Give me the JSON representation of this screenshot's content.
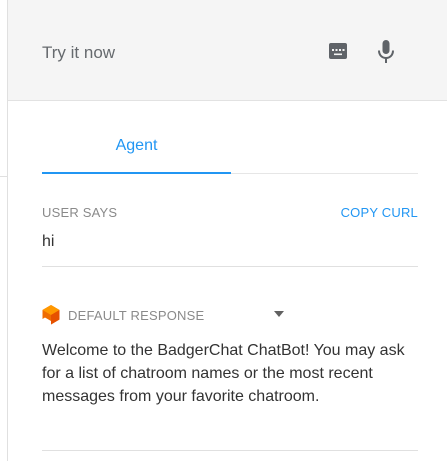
{
  "try_it": {
    "placeholder": "Try it now",
    "keyboard_icon": "keyboard-icon",
    "mic_icon": "microphone-icon"
  },
  "tabs": [
    {
      "label": "Agent",
      "active": true
    }
  ],
  "user_says": {
    "label": "USER SAYS",
    "copy_curl": "COPY CURL",
    "text": "hi"
  },
  "response": {
    "label": "DEFAULT RESPONSE",
    "icon": "dialogflow-logo-icon",
    "text": "Welcome to the BadgerChat ChatBot! You may ask for a list of chatroom names or the most recent messages from your favorite chatroom."
  },
  "colors": {
    "accent": "#2196f3",
    "logo": "#ef6c00",
    "header_bg": "#f5f5f5"
  }
}
